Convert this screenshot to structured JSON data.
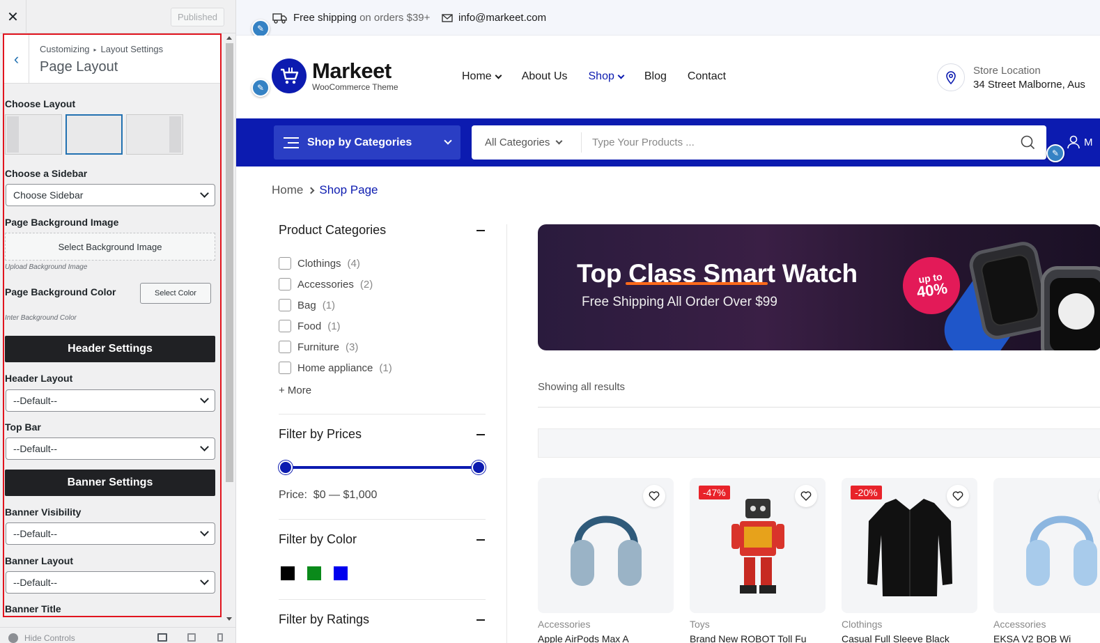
{
  "customizer": {
    "close_icon": "close-icon",
    "publish_label": "Published",
    "breadcrumb": [
      "Customizing",
      "Layout Settings"
    ],
    "section_title": "Page Layout",
    "choose_layout_label": "Choose Layout",
    "layouts": [
      "left-sidebar",
      "full-width",
      "right-sidebar"
    ],
    "selected_layout": "full-width",
    "sidebar_label": "Choose a Sidebar",
    "sidebar_value": "Choose Sidebar",
    "bg_image_label": "Page Background Image",
    "bg_image_button": "Select Background Image",
    "bg_image_desc": "Upload Background Image",
    "bg_color_label": "Page Background Color",
    "bg_color_button": "Select Color",
    "bg_color_desc": "Inter Background Color",
    "header_settings": "Header Settings",
    "header_layout_label": "Header Layout",
    "header_layout_value": "--Default--",
    "top_bar_label": "Top Bar",
    "top_bar_value": "--Default--",
    "banner_settings": "Banner Settings",
    "banner_visibility_label": "Banner Visibility",
    "banner_visibility_value": "--Default--",
    "banner_layout_label": "Banner Layout",
    "banner_layout_value": "--Default--",
    "banner_title_label": "Banner Title",
    "footer_hide_controls": "Hide Controls",
    "highlight_color": "#e1141e",
    "accent_color": "#2271b1"
  },
  "site": {
    "topbar": {
      "shipping_strong": "Free shipping",
      "shipping_rest": "on orders $39+",
      "email": "info@markeet.com"
    },
    "logo": {
      "name": "Markeet",
      "tagline": "WooCommerce Theme"
    },
    "nav": [
      {
        "label": "Home",
        "dropdown": true,
        "active": false
      },
      {
        "label": "About Us",
        "dropdown": false,
        "active": false
      },
      {
        "label": "Shop",
        "dropdown": true,
        "active": true
      },
      {
        "label": "Blog",
        "dropdown": false,
        "active": false
      },
      {
        "label": "Contact",
        "dropdown": false,
        "active": false
      }
    ],
    "store": {
      "label": "Store Location",
      "address": "34 Street Malborne, Aus"
    },
    "categories_button": "Shop by Categories",
    "search": {
      "category": "All Categories",
      "placeholder": "Type Your Products ..."
    },
    "account_initial": "M",
    "breadcrumb": {
      "home": "Home",
      "current": "Shop Page"
    },
    "filters": {
      "categories_title": "Product Categories",
      "categories": [
        {
          "name": "Clothings",
          "count": "(4)"
        },
        {
          "name": "Accessories",
          "count": "(2)"
        },
        {
          "name": "Bag",
          "count": "(1)"
        },
        {
          "name": "Food",
          "count": "(1)"
        },
        {
          "name": "Furniture",
          "count": "(3)"
        },
        {
          "name": "Home appliance",
          "count": "(1)"
        }
      ],
      "more": "+ More",
      "price_title": "Filter by Prices",
      "price_label": "Price:",
      "price_range": "$0 — $1,000",
      "price_min_fraction": 0,
      "price_max_fraction": 1,
      "color_title": "Filter by Color",
      "colors": [
        "#000000",
        "#0a8a1a",
        "#0000ee"
      ],
      "ratings_title": "Filter by Ratings"
    },
    "banner": {
      "title_pre": "Top ",
      "title_mid": "Class Smart",
      "title_post": " Watch",
      "subtitle": "Free Shipping All Order Over $99",
      "badge_top": "up to",
      "badge_value": "40%"
    },
    "results_text": "Showing all results",
    "products": [
      {
        "category": "Accessories",
        "name": "Apple AirPods Max A",
        "discount": "",
        "image": "headphones-icon"
      },
      {
        "category": "Toys",
        "name": "Brand New ROBOT Toll Fu",
        "discount": "-47%",
        "image": "robot-toy-icon"
      },
      {
        "category": "Clothings",
        "name": "Casual Full Sleeve Black",
        "discount": "-20%",
        "image": "shirt-icon"
      },
      {
        "category": "Accessories",
        "name": "EKSA V2 BOB Wi",
        "discount": "",
        "image": "headphones-icon"
      }
    ],
    "brand_color": "#0c1bb0",
    "discount_color": "#e8232a"
  }
}
